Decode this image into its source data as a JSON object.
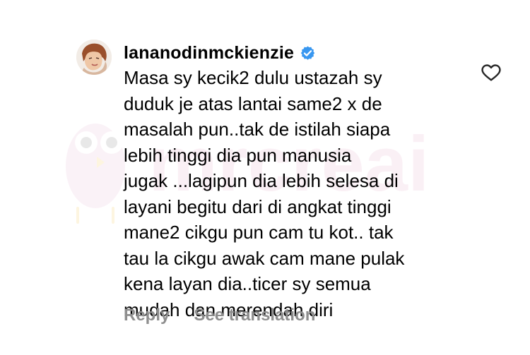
{
  "comment": {
    "username": "lananodinmckienzie",
    "verified": true,
    "text": "Masa sy kecik2 dulu ustazah sy\nduduk je atas lantai same2 x de\nmasalah pun..tak de istilah siapa\nlebih tinggi dia pun manusia\njugak ...lagipun dia lebih selesa di\nlayani begitu dari di angkat tinggi\nmane2 cikgu pun cam tu kot.. tak\ntau la cikgu awak cam mane pulak\nkena layan dia..ticer sy semua\nmudah dan merendah diri",
    "actions": {
      "reply_label": "Reply",
      "translate_label": "See translation"
    }
  },
  "icons": {
    "like": "heart-outline-icon",
    "verified": "verified-badge-icon"
  },
  "colors": {
    "verified": "#3897f0",
    "muted_text": "#8e8e8e",
    "watermark": "#e7a8c8"
  }
}
